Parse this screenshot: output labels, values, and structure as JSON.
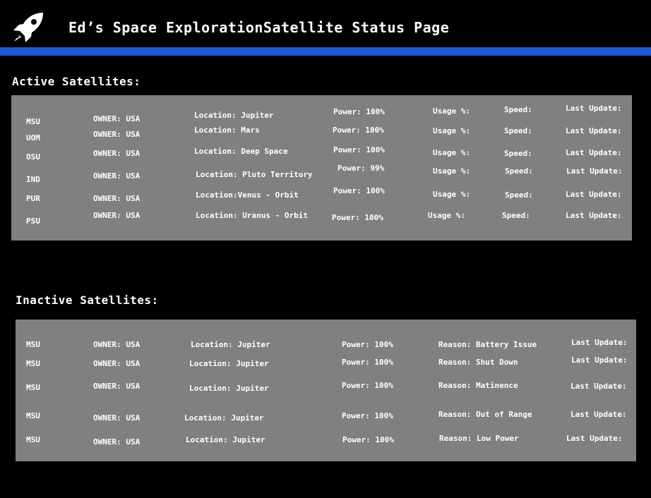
{
  "header": {
    "title": "Ed’s Space ExplorationSatellite Status Page",
    "logo_icon": "rocket-icon",
    "bar_color": "#1f5ad6"
  },
  "active": {
    "title": "Active Satellites:",
    "rows": [
      {
        "name": "MSU",
        "owner": "OWNER: USA",
        "location": "Location: Jupiter",
        "power": "Power: 100%",
        "usage": "Usage %:",
        "speed": "Speed:",
        "update": "Last Update:"
      },
      {
        "name": "UOM",
        "owner": "OWNER: USA",
        "location": "Location: Mars",
        "power": "Power: 100%",
        "usage": "Usage %:",
        "speed": "Speed:",
        "update": "Last Update:"
      },
      {
        "name": "OSU",
        "owner": "OWNER: USA",
        "location": "Location: Deep Space",
        "power": "Power: 100%",
        "usage": "Usage %:",
        "speed": "Speed:",
        "update": "Last Update:"
      },
      {
        "name": "IND",
        "owner": "OWNER: USA",
        "location": "Location: Pluto Territory",
        "power": "Power: 99%",
        "usage": "Usage %:",
        "speed": "Speed:",
        "update": "Last Update:"
      },
      {
        "name": "PUR",
        "owner": "OWNER: USA",
        "location": "Location:Venus - Orbit",
        "power": "Power: 100%",
        "usage": "Usage %:",
        "speed": "Speed:",
        "update": "Last Update:"
      },
      {
        "name": "PSU",
        "owner": "OWNER: USA",
        "location": "Location: Uranus - Orbit",
        "power": "Power: 100%",
        "usage": "Usage %:",
        "speed": "Speed:",
        "update": "Last Update:"
      }
    ]
  },
  "inactive": {
    "title": "Inactive Satellites:",
    "rows": [
      {
        "name": "MSU",
        "owner": "OWNER: USA",
        "location": "Location: Jupiter",
        "power": "Power: 100%",
        "reason": "Reason: Battery Issue",
        "update": "Last Update:"
      },
      {
        "name": "MSU",
        "owner": "OWNER: USA",
        "location": "Location: Jupiter",
        "power": "Power: 100%",
        "reason": "Reason: Shut Down",
        "update": "Last Update:"
      },
      {
        "name": "MSU",
        "owner": "OWNER: USA",
        "location": "Location: Jupiter",
        "power": "Power: 100%",
        "reason": "Reason: Matinence",
        "update": "Last Update:"
      },
      {
        "name": "MSU",
        "owner": "OWNER: USA",
        "location": "Location: Jupiter",
        "power": "Power: 100%",
        "reason": "Reason: Out of Range",
        "update": "Last Update:"
      },
      {
        "name": "MSU",
        "owner": "OWNER: USA",
        "location": "Location: Jupiter",
        "power": "Power: 100%",
        "reason": "Reason: Low Power",
        "update": "Last Update:"
      }
    ]
  }
}
